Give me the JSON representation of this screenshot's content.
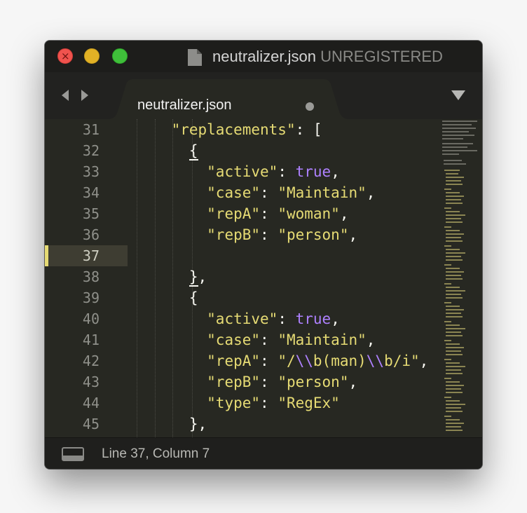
{
  "window": {
    "title_file": "neutralizer.json",
    "title_registration": "UNREGISTERED"
  },
  "tab": {
    "label": "neutralizer.json",
    "modified": true
  },
  "editor": {
    "current_line": 37,
    "lines": [
      {
        "num": "31",
        "tokens": [
          {
            "t": "    ",
            "c": "punc"
          },
          {
            "t": "\"replacements\"",
            "c": "key"
          },
          {
            "t": ": [",
            "c": "punc"
          }
        ]
      },
      {
        "num": "32",
        "tokens": [
          {
            "t": "      ",
            "c": "punc"
          },
          {
            "t": "{",
            "c": "punc",
            "u": true
          }
        ]
      },
      {
        "num": "33",
        "tokens": [
          {
            "t": "        ",
            "c": "punc"
          },
          {
            "t": "\"active\"",
            "c": "key"
          },
          {
            "t": ": ",
            "c": "punc"
          },
          {
            "t": "true",
            "c": "bool"
          },
          {
            "t": ",",
            "c": "punc"
          }
        ]
      },
      {
        "num": "34",
        "tokens": [
          {
            "t": "        ",
            "c": "punc"
          },
          {
            "t": "\"case\"",
            "c": "key"
          },
          {
            "t": ": ",
            "c": "punc"
          },
          {
            "t": "\"Maintain\"",
            "c": "str"
          },
          {
            "t": ",",
            "c": "punc"
          }
        ]
      },
      {
        "num": "35",
        "tokens": [
          {
            "t": "        ",
            "c": "punc"
          },
          {
            "t": "\"repA\"",
            "c": "key"
          },
          {
            "t": ": ",
            "c": "punc"
          },
          {
            "t": "\"woman\"",
            "c": "str"
          },
          {
            "t": ",",
            "c": "punc"
          }
        ]
      },
      {
        "num": "36",
        "tokens": [
          {
            "t": "        ",
            "c": "punc"
          },
          {
            "t": "\"repB\"",
            "c": "key"
          },
          {
            "t": ": ",
            "c": "punc"
          },
          {
            "t": "\"person\"",
            "c": "str"
          },
          {
            "t": ",",
            "c": "punc"
          }
        ]
      },
      {
        "num": "37",
        "tokens": []
      },
      {
        "num": "38",
        "tokens": [
          {
            "t": "      ",
            "c": "punc"
          },
          {
            "t": "}",
            "c": "punc",
            "u": true
          },
          {
            "t": ",",
            "c": "punc"
          }
        ]
      },
      {
        "num": "39",
        "tokens": [
          {
            "t": "      ",
            "c": "punc"
          },
          {
            "t": "{",
            "c": "punc"
          }
        ]
      },
      {
        "num": "40",
        "tokens": [
          {
            "t": "        ",
            "c": "punc"
          },
          {
            "t": "\"active\"",
            "c": "key"
          },
          {
            "t": ": ",
            "c": "punc"
          },
          {
            "t": "true",
            "c": "bool"
          },
          {
            "t": ",",
            "c": "punc"
          }
        ]
      },
      {
        "num": "41",
        "tokens": [
          {
            "t": "        ",
            "c": "punc"
          },
          {
            "t": "\"case\"",
            "c": "key"
          },
          {
            "t": ": ",
            "c": "punc"
          },
          {
            "t": "\"Maintain\"",
            "c": "str"
          },
          {
            "t": ",",
            "c": "punc"
          }
        ]
      },
      {
        "num": "42",
        "tokens": [
          {
            "t": "        ",
            "c": "punc"
          },
          {
            "t": "\"repA\"",
            "c": "key"
          },
          {
            "t": ": ",
            "c": "punc"
          },
          {
            "t": "\"/",
            "c": "str"
          },
          {
            "t": "\\\\",
            "c": "esc"
          },
          {
            "t": "b(man)",
            "c": "str"
          },
          {
            "t": "\\\\",
            "c": "esc"
          },
          {
            "t": "b/i\"",
            "c": "str"
          },
          {
            "t": ",",
            "c": "punc"
          }
        ]
      },
      {
        "num": "43",
        "tokens": [
          {
            "t": "        ",
            "c": "punc"
          },
          {
            "t": "\"repB\"",
            "c": "key"
          },
          {
            "t": ": ",
            "c": "punc"
          },
          {
            "t": "\"person\"",
            "c": "str"
          },
          {
            "t": ",",
            "c": "punc"
          }
        ]
      },
      {
        "num": "44",
        "tokens": [
          {
            "t": "        ",
            "c": "punc"
          },
          {
            "t": "\"type\"",
            "c": "key"
          },
          {
            "t": ": ",
            "c": "punc"
          },
          {
            "t": "\"RegEx\"",
            "c": "str"
          }
        ]
      },
      {
        "num": "45",
        "tokens": [
          {
            "t": "      ",
            "c": "punc"
          },
          {
            "t": "}",
            "c": "punc"
          },
          {
            "t": ",",
            "c": "punc"
          }
        ]
      }
    ]
  },
  "status": {
    "position": "Line 37, Column 7"
  },
  "colors": {
    "background": "#272822",
    "string": "#e6db74",
    "constant": "#ae81ff",
    "text": "#f8f8f2",
    "line_number": "#8f908a"
  },
  "icons": {
    "close": "close-icon",
    "file": "file-icon",
    "nav_back": "chevron-left-icon",
    "nav_forward": "chevron-right-icon",
    "tab_menu": "triangle-down-icon",
    "panel": "panel-toggle-icon"
  }
}
